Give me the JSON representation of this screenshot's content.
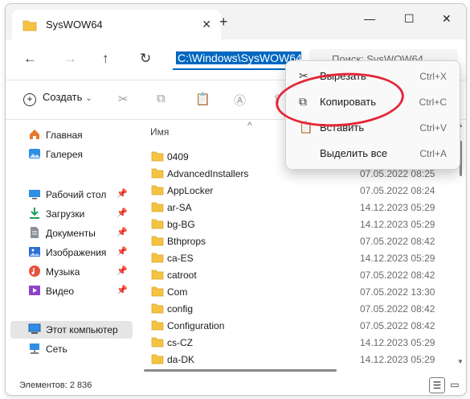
{
  "window": {
    "tab_title": "SysWOW64",
    "tab_close": "✕",
    "new_tab": "+",
    "minimize": "—",
    "maximize": "☐",
    "close": "✕"
  },
  "address": {
    "path": "C:\\Windows\\SysWOW64",
    "search_placeholder": "Поиск: SysWOW64"
  },
  "toolbar": {
    "create_label": "Создать",
    "create_chevron": "⌄"
  },
  "sidebar": {
    "items": [
      {
        "label": "Главная",
        "icon": "home-icon"
      },
      {
        "label": "Галерея",
        "icon": "gallery-icon"
      },
      {
        "label": "Рабочий стол",
        "icon": "desktop-icon",
        "pinned": true
      },
      {
        "label": "Загрузки",
        "icon": "download-icon",
        "pinned": true
      },
      {
        "label": "Документы",
        "icon": "documents-icon",
        "pinned": true
      },
      {
        "label": "Изображения",
        "icon": "pictures-icon",
        "pinned": true
      },
      {
        "label": "Музыка",
        "icon": "music-icon",
        "pinned": true
      },
      {
        "label": "Видео",
        "icon": "video-icon",
        "pinned": true
      },
      {
        "label": "Этот компьютер",
        "icon": "computer-icon",
        "selected": true
      },
      {
        "label": "Сеть",
        "icon": "network-icon"
      }
    ],
    "pin_glyph": "📌"
  },
  "content": {
    "column_name": "Имя",
    "sort_glyph": "^",
    "rows": [
      {
        "name": "0409",
        "date": ""
      },
      {
        "name": "AdvancedInstallers",
        "date": "07.05.2022 08:25"
      },
      {
        "name": "AppLocker",
        "date": "07.05.2022 08:24"
      },
      {
        "name": "ar-SA",
        "date": "14.12.2023 05:29"
      },
      {
        "name": "bg-BG",
        "date": "14.12.2023 05:29"
      },
      {
        "name": "Bthprops",
        "date": "07.05.2022 08:42"
      },
      {
        "name": "ca-ES",
        "date": "14.12.2023 05:29"
      },
      {
        "name": "catroot",
        "date": "07.05.2022 08:42"
      },
      {
        "name": "Com",
        "date": "07.05.2022 13:30"
      },
      {
        "name": "config",
        "date": "07.05.2022 08:42"
      },
      {
        "name": "Configuration",
        "date": "07.05.2022 08:42"
      },
      {
        "name": "cs-CZ",
        "date": "14.12.2023 05:29"
      },
      {
        "name": "da-DK",
        "date": "14.12.2023 05:29"
      }
    ]
  },
  "status": {
    "items_count": "Элементов: 2 836"
  },
  "context_menu": {
    "items": [
      {
        "label": "Вырезать",
        "shortcut": "Ctrl+X",
        "icon": "scissors-icon"
      },
      {
        "label": "Копировать",
        "shortcut": "Ctrl+C",
        "icon": "copy-icon"
      },
      {
        "label": "Вставить",
        "shortcut": "Ctrl+V",
        "icon": "paste-icon"
      },
      {
        "label": "Выделить все",
        "shortcut": "Ctrl+A",
        "icon": ""
      }
    ]
  },
  "colors": {
    "accent": "#0067c0",
    "highlight_ellipse": "#e3283a",
    "folder": "#f5c342"
  }
}
